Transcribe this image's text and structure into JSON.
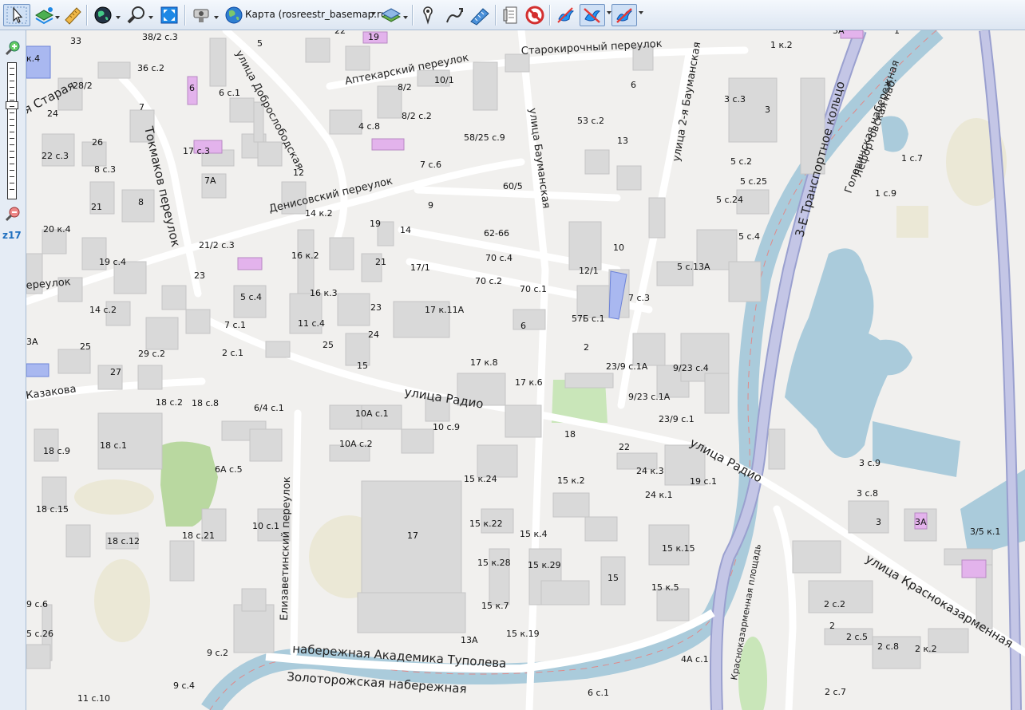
{
  "toolbar": {
    "basemap_label": "Карта (rosreestr_basemap.ru)",
    "icons": [
      "pointer-icon",
      "layers-icon",
      "ruler-icon",
      "globe-icon",
      "magnifier-icon",
      "fullscreen-icon",
      "satellite-icon",
      "basemap-globe-icon",
      "layer-stack-icon",
      "pin-icon",
      "route-icon",
      "measure-icon",
      "notes-icon",
      "no-entry-icon",
      "bird-icon",
      "bird-crossed-icon",
      "bird-pin-icon"
    ]
  },
  "zoom": {
    "level": "z17"
  },
  "streets": [
    "Старокирочный переулок",
    "Аптекарский переулок",
    "улица Доброслободская",
    "Денисовский переулок",
    "Токмаков переулок",
    "улица Бауманская",
    "улица 2-я Бауманская",
    "улица Радио",
    "улица Радио",
    "3-Е Транспортное кольцо",
    "Лефортовская наб.",
    "Головинская набережная",
    "улица Красноказарменная",
    "набережная Академика Туполева",
    "Золоторожская набережная",
    "Красноказарменная площадь",
    "Елизаветинский переулок",
    "я Старая",
    "Казакова",
    "ереулок"
  ],
  "house_labels": [
    "33",
    "38/2 с.3",
    "5",
    "22",
    "19",
    "3А",
    "1",
    "1 к.2",
    "к.4",
    "36 с.2",
    "6",
    "6 с.1",
    "8/2",
    "10/1",
    "6",
    "3 с.3",
    "3",
    "28/2",
    "7",
    "24",
    "8/2 с.2",
    "4 с.8",
    "58/25 с.9",
    "53 с.2",
    "26",
    "13",
    "17 с.3",
    "22 с.3",
    "8 с.3",
    "7А",
    "12",
    "7 с.6",
    "60/5",
    "5 с.2",
    "5 с.25",
    "1 с.7",
    "5 с.24",
    "1 с.9",
    "21",
    "8",
    "9",
    "14 к.2",
    "20 к.4",
    "19",
    "14",
    "62-66",
    "10",
    "5 с.4",
    "21/2 с.3",
    "16 к.2",
    "19 с.4",
    "21",
    "17/1",
    "70 с.4",
    "12/1",
    "5 с.13А",
    "23",
    "70 с.2",
    "70 с.1",
    "16 к.3",
    "5 с.4",
    "7 с.3",
    "14 с.2",
    "23",
    "17 к.11А",
    "57Б с.1",
    "7 с.1",
    "11 с.4",
    "6",
    "24",
    "3А",
    "25",
    "25",
    "2",
    "29 с.2",
    "2 с.1",
    "15",
    "17 к.8",
    "23/9 с.1А",
    "9/23 с.4",
    "27",
    "17 к.6",
    "9/23 с.1А",
    "18 с.2",
    "18 с.8",
    "6/4 с.1",
    "10А с.1",
    "23/9 с.1",
    "10 с.9",
    "18",
    "10А с.2",
    "22",
    "18 с.1",
    "18 с.9",
    "6А с.5",
    "24 к.3",
    "3 с.9",
    "15 к.24",
    "15 к.2",
    "19 с.1",
    "18 с.15",
    "24 к.1",
    "3 с.8",
    "17",
    "15 к.22",
    "3",
    "3А",
    "3/5 к.1",
    "10 с.1",
    "15 к.4",
    "18 с.12",
    "18 с.21",
    "15 к.15",
    "15 к.28",
    "15 к.29",
    "15",
    "15 к.5",
    "9 с.6",
    "15 к.7",
    "2 с.2",
    "5 с.26",
    "2",
    "2 с.5",
    "15 к.19",
    "13А",
    "2 с.8",
    "2 к.2",
    "9 с.2",
    "4А с.1",
    "9 с.4",
    "2 с.7",
    "11 с.10",
    "6 с.1"
  ],
  "colors": {
    "accent": "#1f6fbf",
    "water": "#aacbdb",
    "ring": "#c4c6e6",
    "buildings": "#d9d9d9",
    "special": "#e3b3ec"
  }
}
